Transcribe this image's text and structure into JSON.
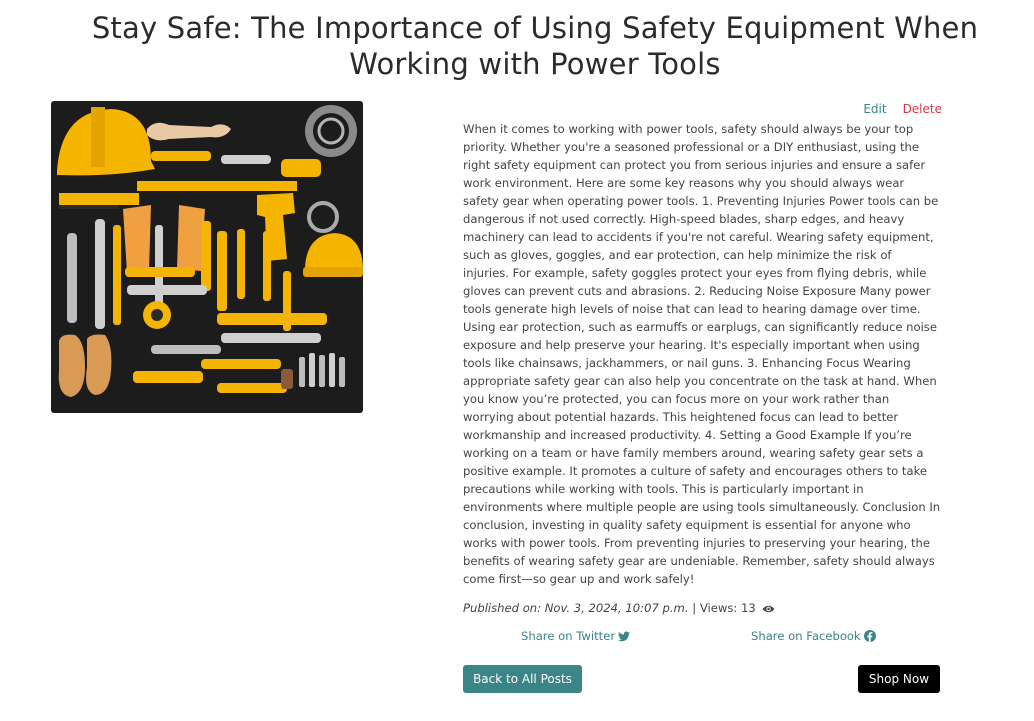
{
  "post": {
    "title": "Stay Safe: The Importance of Using Safety Equipment When Working with Power Tools",
    "body": "When it comes to working with power tools, safety should always be your top priority. Whether you're a seasoned professional or a DIY enthusiast, using the right safety equipment can protect you from serious injuries and ensure a safer work environment. Here are some key reasons why you should always wear safety gear when operating power tools. 1. Preventing Injuries Power tools can be dangerous if not used correctly. High-speed blades, sharp edges, and heavy machinery can lead to accidents if you're not careful. Wearing safety equipment, such as gloves, goggles, and ear protection, can help minimize the risk of injuries. For example, safety goggles protect your eyes from flying debris, while gloves can prevent cuts and abrasions. 2. Reducing Noise Exposure Many power tools generate high levels of noise that can lead to hearing damage over time. Using ear protection, such as earmuffs or earplugs, can significantly reduce noise exposure and help preserve your hearing. It's especially important when using tools like chainsaws, jackhammers, or nail guns. 3. Enhancing Focus Wearing appropriate safety gear can also help you concentrate on the task at hand. When you know you’re protected, you can focus more on your work rather than worrying about potential hazards. This heightened focus can lead to better workmanship and increased productivity. 4. Setting a Good Example If you’re working on a team or have family members around, wearing safety gear sets a positive example. It promotes a culture of safety and encourages others to take precautions while working with tools. This is particularly important in environments where multiple people are using tools simultaneously. Conclusion In conclusion, investing in quality safety equipment is essential for anyone who works with power tools. From preventing injuries to preserving your hearing, the benefits of wearing safety gear are undeniable. Remember, safety should always come first—so gear up and work safely!",
    "published": "Published on: Nov. 3, 2024, 10:07 p.m.",
    "views_label": "| Views: 13"
  },
  "actions": {
    "edit_label": "Edit",
    "delete_label": "Delete"
  },
  "share": {
    "twitter_label": "Share on Twitter",
    "facebook_label": "Share on Facebook"
  },
  "buttons": {
    "back_label": "Back to All Posts",
    "shop_label": "Shop Now"
  },
  "colors": {
    "accent": "#3a8588",
    "danger": "#dc3545",
    "shop": "#000000",
    "tool_yellow": "#f5b400"
  },
  "icons": {
    "views": "eye-icon",
    "twitter": "twitter-icon",
    "facebook": "facebook-icon"
  }
}
